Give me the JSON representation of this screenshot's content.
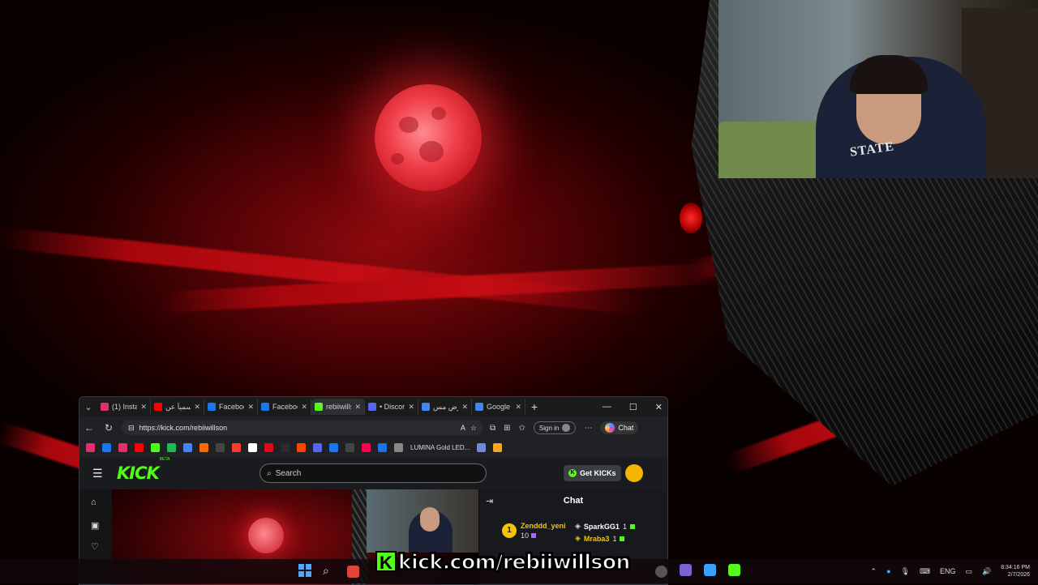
{
  "browser": {
    "tabs": [
      {
        "title": "(1) Insta",
        "icon": "instagram-icon",
        "color": "#e1306c",
        "active": false
      },
      {
        "title": "رسمياً عن",
        "icon": "youtube-icon",
        "color": "#ff0000",
        "active": false
      },
      {
        "title": "Facebook",
        "icon": "facebook-icon",
        "color": "#1877f2",
        "active": false
      },
      {
        "title": "Facebook",
        "icon": "facebook-icon",
        "color": "#1877f2",
        "active": false
      },
      {
        "title": "rebiiwills",
        "icon": "kick-icon",
        "color": "#53fc18",
        "active": true
      },
      {
        "title": "• Discord",
        "icon": "discord-icon",
        "color": "#5865f2",
        "active": false
      },
      {
        "title": "الأرض مس",
        "icon": "google-icon",
        "color": "#4285f4",
        "active": false
      },
      {
        "title": "Google",
        "icon": "google-icon",
        "color": "#4285f4",
        "active": false
      }
    ],
    "url": "https://kick.com/rebiiwillson",
    "signin_label": "Sign in",
    "chat_label": "Chat",
    "bookmarks_label": "LUMINA Gold LED...",
    "bookmark_colors": [
      "#e1306c",
      "#1877f2",
      "#e1306c",
      "#ff0000",
      "#53fc18",
      "#1db954",
      "#4285f4",
      "#ff6a00",
      "#444",
      "#ff3b30",
      "#ffffff",
      "#e50914",
      "#2b2b2b",
      "#ff4500",
      "#5865f2",
      "#1877f2",
      "#444",
      "#ff0050",
      "#1a73e8",
      "#888",
      "#7289da",
      "#f5a623"
    ]
  },
  "kick": {
    "logo": "KICK",
    "beta": "BETA",
    "search_placeholder": "Search",
    "get_kicks_label": "Get KICKs",
    "chat_title": "Chat",
    "leaderboard": [
      {
        "rank": "1",
        "name": "Zenddd_yeni",
        "count": "10"
      },
      {
        "name": "SparkGG1",
        "count": "1"
      },
      {
        "name": "Mraba3",
        "count": "1"
      }
    ]
  },
  "banner": {
    "k": "K",
    "text": "kick.com/rebiiwillson"
  },
  "webcam": {
    "shirt_text": "STATE"
  },
  "taskbar": {
    "lang": "ENG",
    "time": "8:34:16 PM",
    "date": "2/7/2026"
  }
}
